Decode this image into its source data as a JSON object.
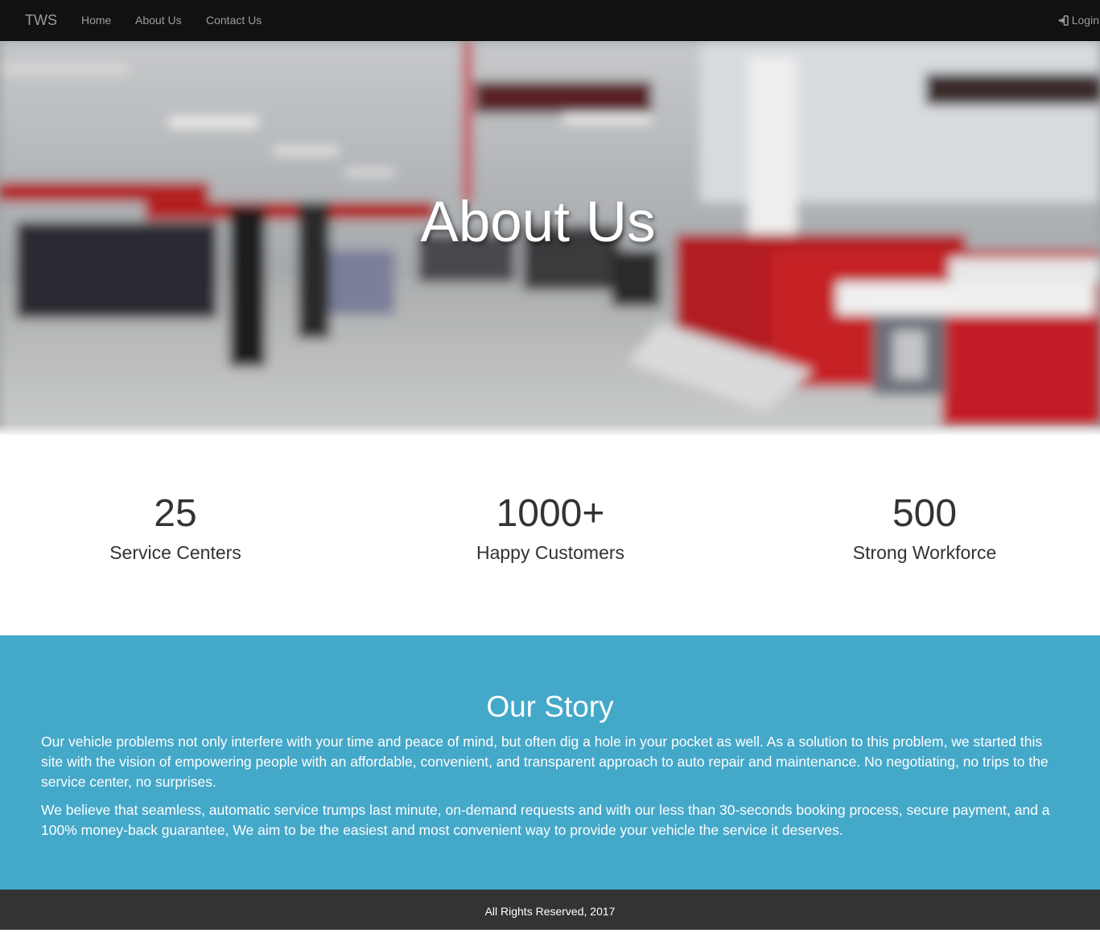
{
  "navbar": {
    "brand": "TWS",
    "links": [
      {
        "label": "Home"
      },
      {
        "label": "About Us"
      },
      {
        "label": "Contact Us"
      }
    ],
    "login_label": "Login",
    "login_icon": "sign-in-icon"
  },
  "hero": {
    "title": "About Us"
  },
  "stats": [
    {
      "value": "25",
      "label": "Service Centers"
    },
    {
      "value": "1000+",
      "label": "Happy Customers"
    },
    {
      "value": "500",
      "label": "Strong Workforce"
    }
  ],
  "story": {
    "title": "Our Story",
    "paragraphs": [
      "Our vehicle problems not only interfere with your time and peace of mind, but often dig a hole in your pocket as well. As a solution to this problem, we started this site with the vision of empowering people with an affordable, convenient, and transparent approach to auto repair and maintenance. No negotiating, no trips to the service center, no surprises.",
      "We believe that seamless, automatic service trumps last minute, on-demand requests and with our less than 30-seconds booking process, secure payment, and a 100% money-back guarantee, We aim to be the easiest and most convenient way to provide your vehicle the service it deserves."
    ]
  },
  "footer": {
    "text": "All Rights Reserved, 2017"
  },
  "colors": {
    "navbar_bg": "#111111",
    "nav_text": "#9d9d9d",
    "story_bg": "#44a8c9",
    "footer_bg": "#333333",
    "stat_text": "#333333"
  }
}
